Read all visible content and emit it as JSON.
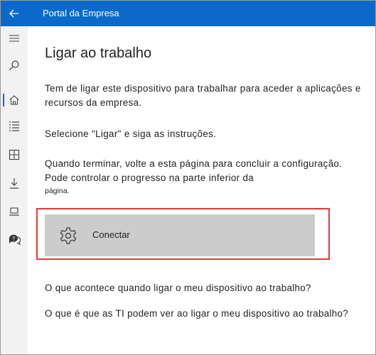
{
  "app": {
    "title": "Portal da Empresa"
  },
  "sidebar": {
    "items": [
      {
        "icon": "menu-icon"
      },
      {
        "icon": "search-icon"
      },
      {
        "icon": "home-icon",
        "active": true
      },
      {
        "icon": "apps-list-icon"
      },
      {
        "icon": "categories-icon"
      },
      {
        "icon": "download-icon"
      },
      {
        "icon": "devices-icon"
      },
      {
        "icon": "help-support-icon"
      }
    ]
  },
  "main": {
    "title": "Ligar ao trabalho",
    "intro": "Tem de ligar este dispositivo para trabalhar para aceder a aplicações e recursos da empresa.",
    "instruction": "Selecione \"Ligar\" e siga as instruções.",
    "finish_line1": "Quando terminar, volte a esta página para concluir a configuração.",
    "finish_line2": "Pode controlar o progresso na parte inferior da",
    "finish_small": "página.",
    "connect_button": {
      "label": "Conectar",
      "icon": "gear-icon"
    },
    "links": [
      "O que acontece quando ligar o meu dispositivo ao trabalho?",
      "O que é que as TI podem ver ao ligar o meu dispositivo ao trabalho?"
    ]
  },
  "colors": {
    "titlebar": "#0b6ac9",
    "sidebar": "#f2f2f2",
    "button": "#cccccc",
    "highlight": "#e23a3a"
  }
}
